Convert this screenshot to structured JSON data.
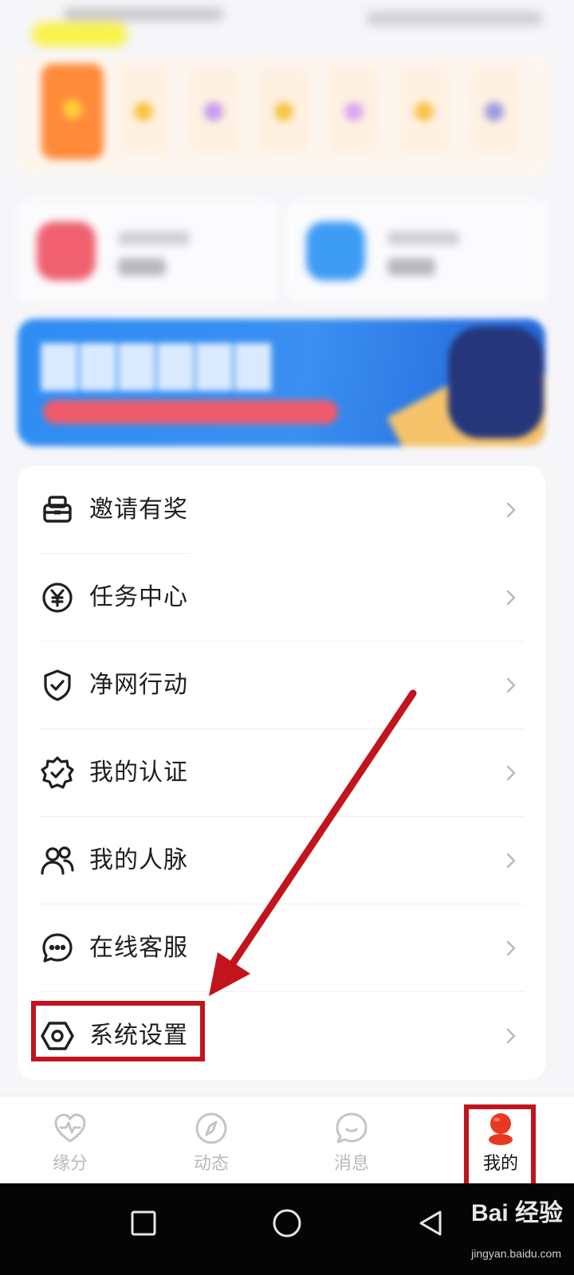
{
  "menu": {
    "items": [
      {
        "label": "邀请有奖",
        "icon": "gift-box-icon"
      },
      {
        "label": "任务中心",
        "icon": "yen-coin-icon"
      },
      {
        "label": "净网行动",
        "icon": "shield-check-icon"
      },
      {
        "label": "我的认证",
        "icon": "badge-check-icon"
      },
      {
        "label": "我的人脉",
        "icon": "people-icon"
      },
      {
        "label": "在线客服",
        "icon": "chat-bubble-icon"
      },
      {
        "label": "系统设置",
        "icon": "settings-hexagon-icon"
      }
    ]
  },
  "tabbar": {
    "tabs": [
      {
        "label": "缘分",
        "icon": "heart-pulse-icon",
        "active": false
      },
      {
        "label": "动态",
        "icon": "compass-icon",
        "active": false
      },
      {
        "label": "消息",
        "icon": "message-smile-icon",
        "active": false
      },
      {
        "label": "我的",
        "icon": "profile-avatar-icon",
        "active": true
      }
    ]
  },
  "annotation": {
    "highlight_color": "#c1141c"
  },
  "watermark": {
    "brand": "Bai 经验",
    "url": "jingyan.baidu.com"
  },
  "colors": {
    "accent_red": "#e8381f",
    "inactive_gray": "#b9b9be",
    "banner_blue": "#2f8df2"
  }
}
